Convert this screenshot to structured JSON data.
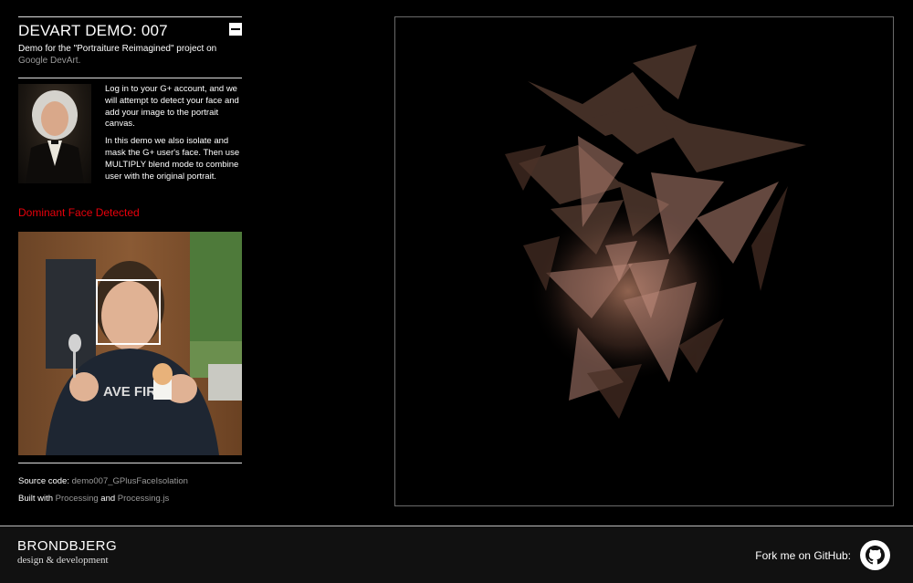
{
  "sidebar": {
    "title": "DEVART DEMO: 007",
    "subtitle_prefix": "Demo for the \"Portraiture Reimagined\" project on",
    "subtitle_link": "Google DevArt.",
    "intro_p1": "Log in to your G+ account, and we will attempt to detect your face and add your image to the portrait canvas.",
    "intro_p2": "In this demo we also isolate and mask the G+ user's face. Then use MULTIPLY blend mode to combine user with the original portrait.",
    "status": "Dominant Face Detected",
    "source_label": "Source code:",
    "source_link": "demo007_GPlusFaceIsolation",
    "built_label": "Built with",
    "built_link1": "Processing",
    "built_and": "and",
    "built_link2": "Processing.js"
  },
  "footer": {
    "brand_name": "BRONDBJERG",
    "brand_tag": "design & development",
    "fork_text": "Fork me on GitHub:"
  },
  "icons": {
    "collapse": "minus-icon",
    "github": "github-octocat-icon"
  },
  "colors": {
    "status_red": "#e8000b",
    "link_gray": "#9a9a9a",
    "background": "#000000"
  }
}
